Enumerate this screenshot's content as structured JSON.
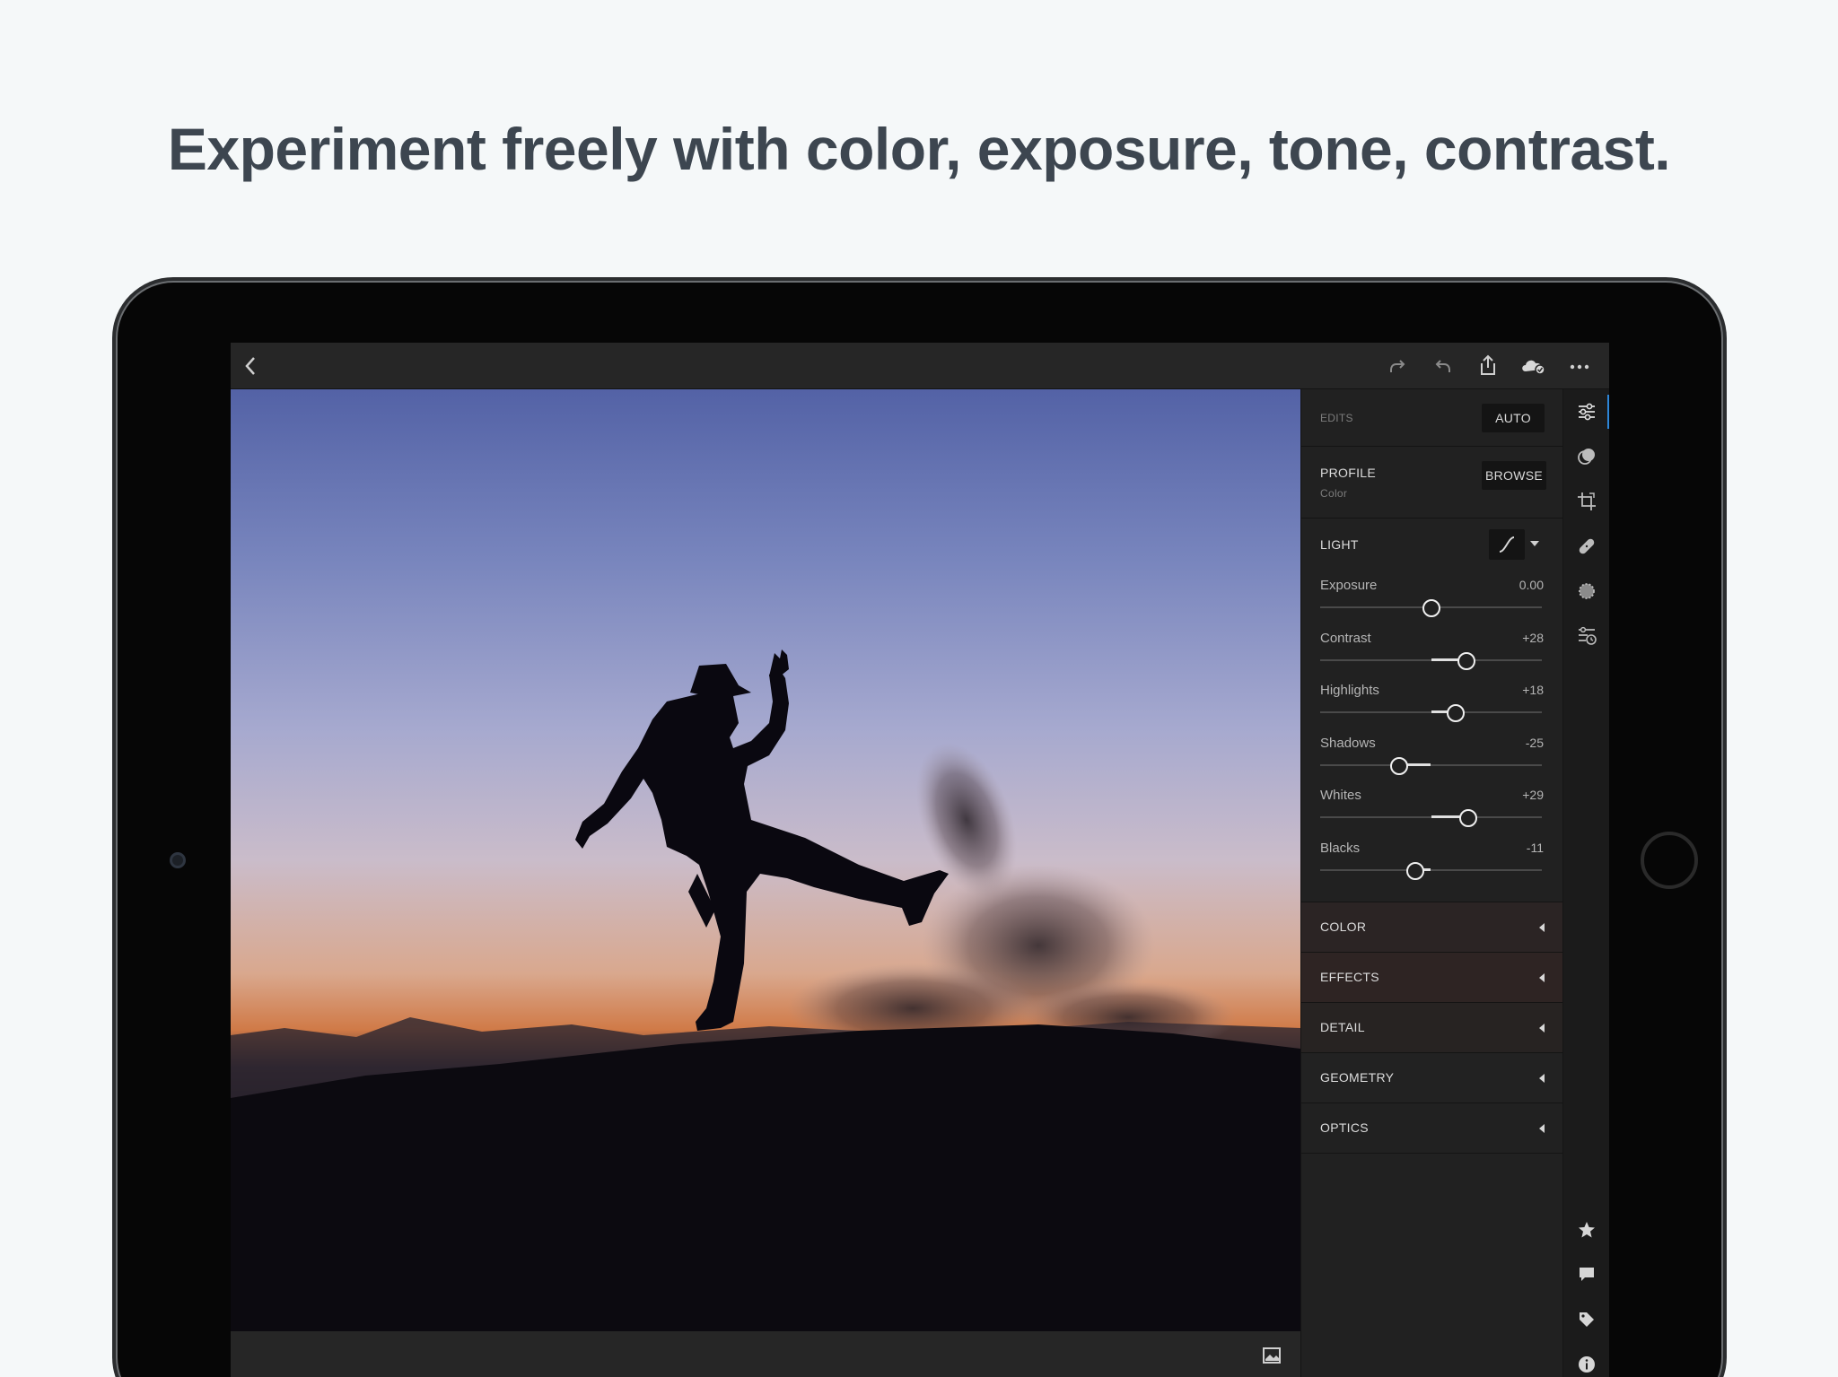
{
  "headline": "Experiment freely with color, exposure, tone, contrast.",
  "colors": {
    "accent": "#2d86d8",
    "panel_bg": "#212121",
    "headline": "#3d4650"
  },
  "topbar": {
    "icons": [
      "back-icon",
      "redo-icon",
      "undo-icon",
      "share-icon",
      "cloud-sync-icon",
      "more-icon"
    ]
  },
  "edits": {
    "label": "EDITS",
    "auto_button": "AUTO"
  },
  "profile": {
    "title": "PROFILE",
    "value": "Color",
    "browse_button": "BROWSE"
  },
  "light": {
    "title": "LIGHT",
    "sliders": [
      {
        "label": "Exposure",
        "value": "0.00",
        "position": 0.5
      },
      {
        "label": "Contrast",
        "value": "+28",
        "position": 0.66
      },
      {
        "label": "Highlights",
        "value": "+18",
        "position": 0.61
      },
      {
        "label": "Shadows",
        "value": "-25",
        "position": 0.355
      },
      {
        "label": "Whites",
        "value": "+29",
        "position": 0.67
      },
      {
        "label": "Blacks",
        "value": "-11",
        "position": 0.43
      }
    ]
  },
  "sections": [
    "COLOR",
    "EFFECTS",
    "DETAIL",
    "GEOMETRY",
    "OPTICS"
  ],
  "rail": {
    "tools": [
      "edit-sliders-icon",
      "presets-icon",
      "crop-icon",
      "healing-icon",
      "selective-icon",
      "versions-icon"
    ],
    "bottom": [
      "star-icon",
      "comment-icon",
      "tag-icon",
      "info-icon"
    ]
  }
}
